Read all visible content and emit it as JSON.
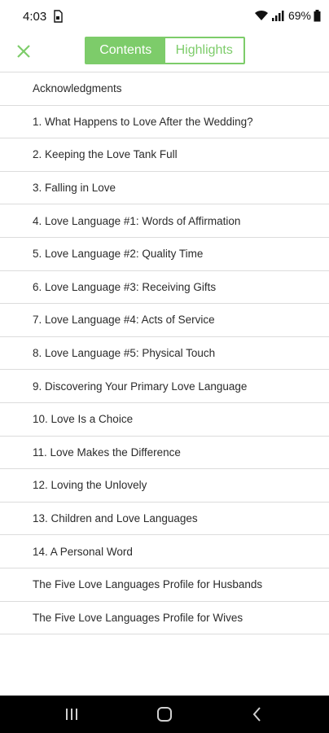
{
  "status_bar": {
    "time": "4:03",
    "battery": "69%",
    "icons": [
      "sim-card-icon",
      "wifi-icon",
      "signal-icon",
      "battery-icon"
    ]
  },
  "toolbar": {
    "close_icon": "close-icon",
    "tabs": [
      {
        "label": "Contents",
        "active": true
      },
      {
        "label": "Highlights",
        "active": false
      }
    ],
    "accent_color": "#7dcc6a"
  },
  "toc": {
    "items": [
      "Acknowledgments",
      "1.  What Happens to Love After the Wedding?",
      "2.  Keeping the Love Tank Full",
      "3.  Falling in Love",
      "4.  Love Language #1: Words of Affirmation",
      "5.  Love Language #2: Quality Time",
      "6.  Love Language #3: Receiving Gifts",
      "7.  Love Language #4: Acts of Service",
      "8.  Love Language #5: Physical Touch",
      "9.  Discovering Your Primary Love Language",
      "10.  Love Is a Choice",
      "11.  Love Makes the Difference",
      "12.  Loving the Unlovely",
      "13.  Children and Love Languages",
      "14.  A Personal Word",
      "The Five Love Languages Profile for Husbands",
      "The Five Love Languages Profile for Wives"
    ]
  },
  "nav_bar": {
    "buttons": [
      "recent-apps-icon",
      "home-icon",
      "back-icon"
    ]
  }
}
